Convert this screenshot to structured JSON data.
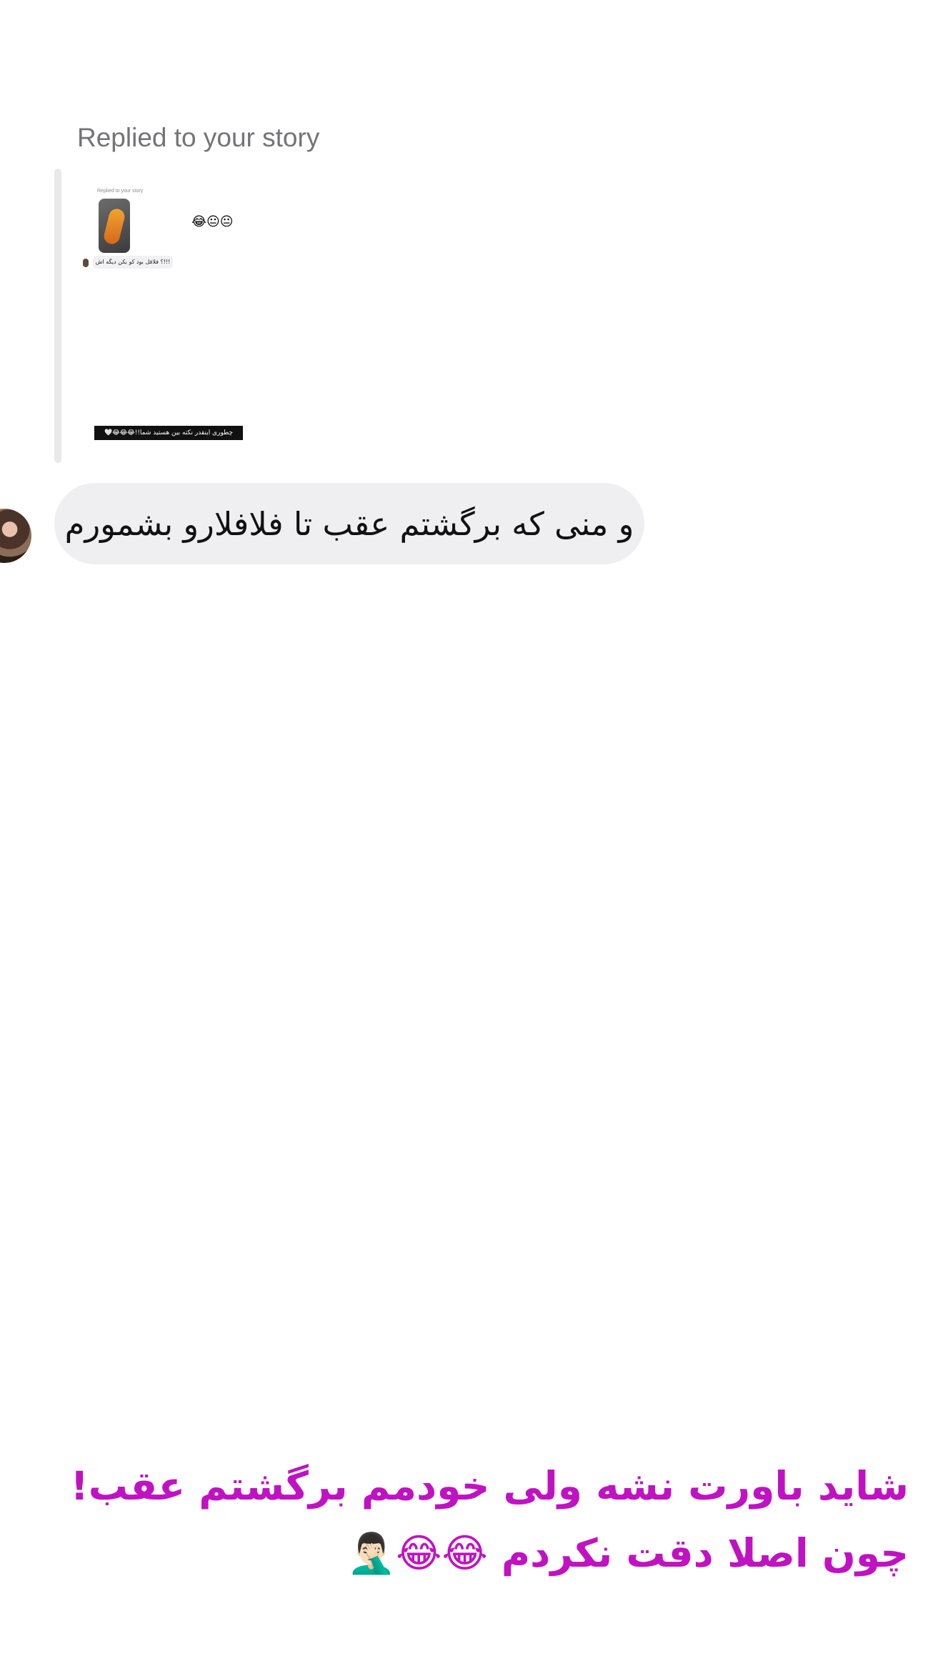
{
  "story_reply": {
    "label": "Replied to your story",
    "thumbnail": {
      "label": "Replied to your story",
      "emojis": "😂😐😐",
      "bubble_text": "!!!؟ فلافل بود کو بکن دیگه اش",
      "caption": "چطوری اینقدر نکته بین هستید شما!!😂😂😂🤍"
    }
  },
  "message": {
    "text": "و منی که برگشتم عقب تا فلافلارو بشمورم"
  },
  "caption": {
    "line1": "شاید باورت نشه ولی خودمم برگشتم عقب!",
    "line2": "چون اصلا دقت نکردم",
    "line2_emojis": "😂😂🤦🏻‍♂️",
    "color": "#c012c2"
  }
}
